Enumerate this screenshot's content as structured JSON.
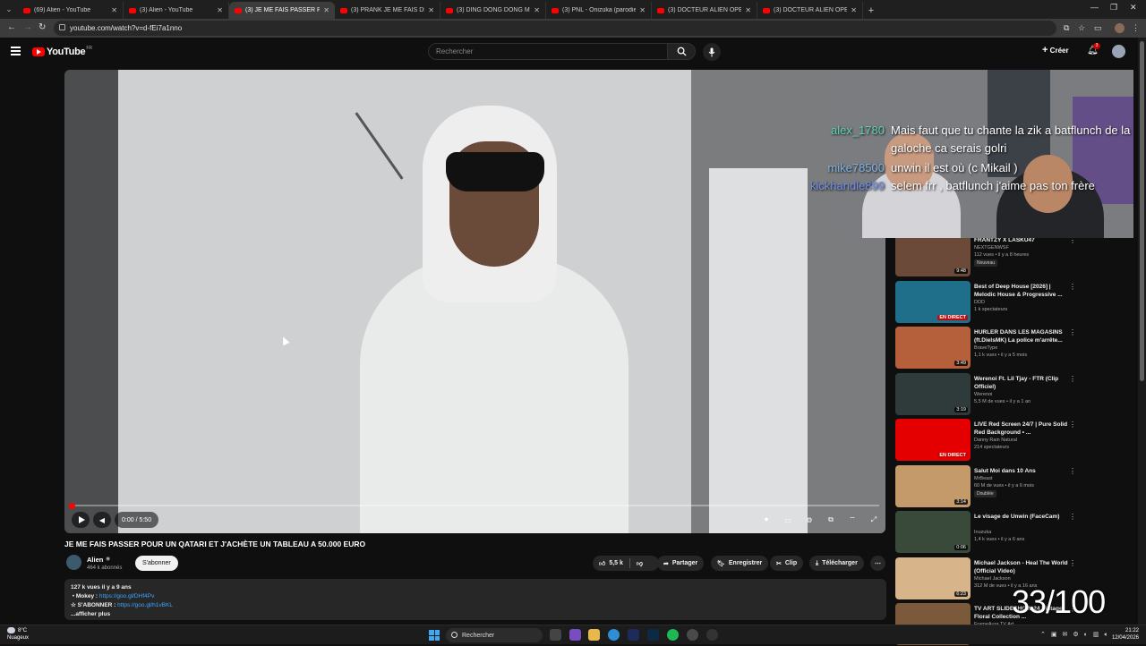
{
  "browser": {
    "tabs": [
      {
        "label": "(69) Alien - YouTube",
        "active": false
      },
      {
        "label": "(3) Alien - YouTube",
        "active": false
      },
      {
        "label": "(3) JE ME FAIS PASSER POUR UN",
        "active": true
      },
      {
        "label": "(3) PRANK JE ME FAIS DÉFONC",
        "active": false
      },
      {
        "label": "(3) DING DONG DONG MUSIC",
        "active": false
      },
      {
        "label": "(3) PNL - Onizuka (parodie) - Y",
        "active": false
      },
      {
        "label": "(3) DOCTEUR ALIEN OPERE UN",
        "active": false
      },
      {
        "label": "(3) DOCTEUR ALIEN OPERE UN",
        "active": false
      }
    ],
    "url": "youtube.com/watch?v=d-fEi7a1nno",
    "profile_initial": "F"
  },
  "masthead": {
    "logo_text": "YouTube",
    "logo_region": "FR",
    "search_placeholder": "Rechercher",
    "create_label": "Créer",
    "notification_count": "3"
  },
  "player": {
    "time": "0:00 / 5:50",
    "progress": 0.0
  },
  "video": {
    "title": "JE ME FAIS PASSER POUR UN QATARI ET J'ACHÈTE UN TABLEAU A 50.000 EURO",
    "channel": "Alien",
    "subscribers": "464 k abonnés",
    "subscribe_label": "S'abonner",
    "likes": "5,5 k",
    "share_label": "Partager",
    "save_label": "Enregistrer",
    "clip_label": "Clip",
    "download_label": "Télécharger",
    "description": {
      "stats": "127 k vues  il y a 9 ans",
      "line1_prefix": "Mokey : ",
      "line1_link": "https://goo.gl/DHf4Pv",
      "line2_prefix": "☆ S'ABONNER : ",
      "line2_link": "https://goo.gl/h1vBKL",
      "more": "...afficher plus"
    }
  },
  "sidebar": {
    "items": [
      {
        "title": "FRANTZY X LASKU47",
        "channel": "NEXTGENWSF",
        "meta": "112 vues • il y a 8 heures",
        "badge": "Nouveau",
        "duration": "9:48",
        "live": false,
        "thumb_color": "#6b4a3a"
      },
      {
        "title": "Best of Deep House [2026] | Melodic House & Progressive ...",
        "channel": "DDD",
        "meta": "1 k spectateurs",
        "badge": "",
        "duration": "EN DIRECT",
        "live": true,
        "thumb_color": "#1f6f8a"
      },
      {
        "title": "HURLER DANS LES MAGASINS (ft.DielsMK) La police m'arrête...",
        "channel": "BraveType",
        "meta": "1,1 k vues • il y a 5 mois",
        "badge": "",
        "duration": "3:49",
        "live": false,
        "thumb_color": "#b5603a"
      },
      {
        "title": "Werenoi Ft. Lil Tjay - FTR (Clip Officiel)",
        "channel": "Werenoi",
        "meta": "5,5 M de vues • il y a 1 an",
        "badge": "",
        "duration": "3:19",
        "live": false,
        "thumb_color": "#2f3a3a"
      },
      {
        "title": "LIVE Red Screen 24/7 | Pure Solid Red Background • ...",
        "channel": "Danny Rain Natural",
        "meta": "214 spectateurs",
        "badge": "",
        "duration": "EN DIRECT",
        "live": true,
        "thumb_color": "#e40000"
      },
      {
        "title": "Salut Moi dans 10 Ans",
        "channel": "MrBeast",
        "meta": "60 M de vues • il y a 6 mois",
        "badge": "Doublée",
        "duration": "3:14",
        "live": false,
        "thumb_color": "#c59a6a"
      },
      {
        "title": "Le visage de Unwin (FaceCam)",
        "channel": "Inuzuka",
        "meta": "1,4 k vues • il y a 6 ans",
        "badge": "",
        "duration": "0:06",
        "live": false,
        "thumb_color": "#3a4a3a"
      },
      {
        "title": "Michael Jackson - Heal The World (Official Video)",
        "channel": "Michael Jackson",
        "meta": "312 M de vues • il y a 16 ans",
        "badge": "",
        "duration": "6:23",
        "live": false,
        "thumb_color": "#d8b48a"
      },
      {
        "title": "TV ART SLIDESHOW 24 Vintage Floral Collection ...",
        "channel": "FrameAura TV Art",
        "meta": "",
        "badge": "",
        "duration": "",
        "live": false,
        "thumb_color": "#7a5a3a"
      }
    ]
  },
  "stream_overlay": {
    "chat": [
      {
        "user": "alex_1780",
        "color": "#5fd3b3",
        "msg": "Mais faut que tu chante la zik a batflunch de la",
        "msg2": "galoche ca serais golri"
      },
      {
        "user": "mike78500",
        "color": "#7fb3e0",
        "msg": "unwin il est où (c Mikail )",
        "msg2": ""
      },
      {
        "user": "kickhandle899",
        "color": "#6f90e8",
        "msg": "selem frr , batflunch j'aime pas ton frère",
        "msg2": ""
      }
    ],
    "counter": "33/100"
  },
  "taskbar": {
    "weather_temp": "8°C",
    "weather_text": "Nuageux",
    "search_label": "Rechercher",
    "time": "21:22",
    "date": "12/04/2026"
  }
}
